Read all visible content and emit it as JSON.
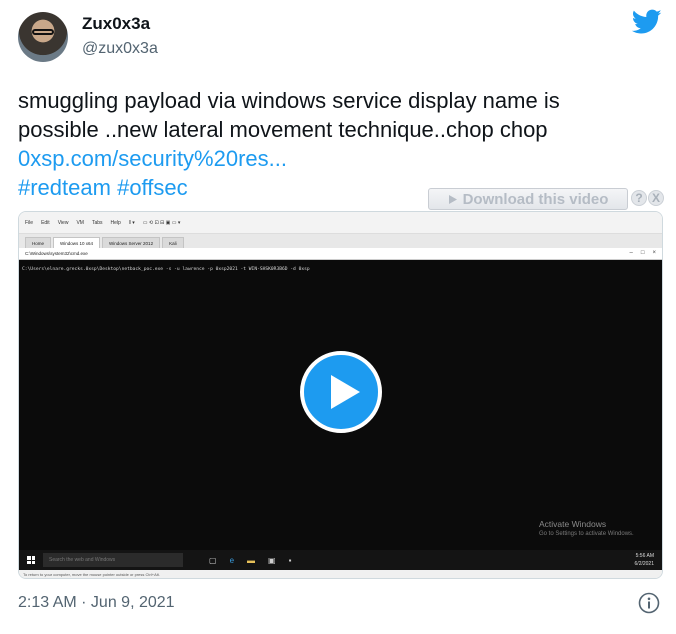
{
  "author": {
    "name": "Zux0x3a",
    "handle": "@zux0x3a",
    "avatar_icon": "avatar-photo"
  },
  "brand_icon": "twitter-bird-icon",
  "colors": {
    "accent": "#1d9bf0",
    "text": "#0f1419",
    "muted": "#536471"
  },
  "tweet": {
    "line1": "smuggling payload via windows service display name is",
    "line2": "possible ..new lateral movement technique..chop chop",
    "link": "0xsp.com/security%20res...",
    "hashtag1": "#redteam",
    "hashtag2": "#offsec"
  },
  "download_badge": {
    "label": "Download this video",
    "help": "?",
    "close": "X"
  },
  "video": {
    "menu": [
      "File",
      "Edit",
      "View",
      "VM",
      "Tabs",
      "Help"
    ],
    "tabs": [
      "Home",
      "Windows 10 x64",
      "Windows Server 2012",
      "Kali"
    ],
    "window_title": "C:\\Windows\\system32\\cmd.exe",
    "console_line": "C:\\Users\\elnare.grecks.0xsp\\Desktop\\netback_poc.exe -s -u lawrence -p 0xsp2021 -t WIN-SHSK0R3B6D -d 0xsp",
    "activate_title": "Activate Windows",
    "activate_sub": "Go to Settings to activate Windows.",
    "search_placeholder": "Search the web and Windows",
    "tray_time": "5:56 AM",
    "tray_date": "6/2/2021",
    "status_text": "To return to your computer, move the mouse pointer outside or press Ctrl+Alt.",
    "play_icon": "play-icon"
  },
  "footer": {
    "timestamp": "2:13 AM · Jun 9, 2021",
    "info_icon": "info-icon"
  }
}
